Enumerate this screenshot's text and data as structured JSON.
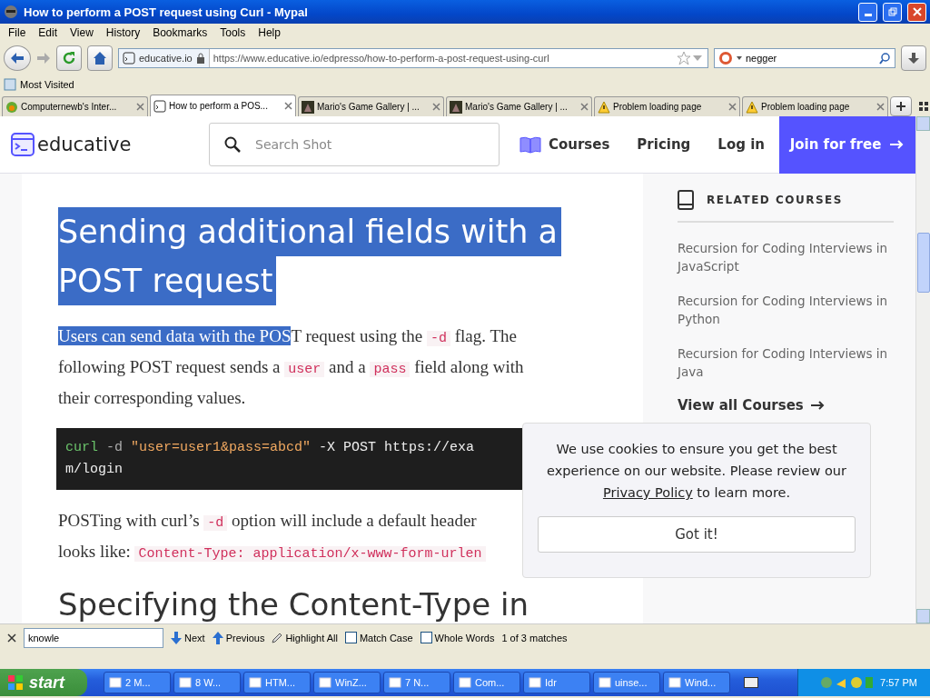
{
  "window": {
    "title": "How to perform a POST request using Curl - Mypal"
  },
  "menu": [
    "File",
    "Edit",
    "View",
    "History",
    "Bookmarks",
    "Tools",
    "Help"
  ],
  "address": {
    "site": "educative.io",
    "url": "https://www.educative.io/edpresso/how-to-perform-a-post-request-using-curl"
  },
  "search": {
    "value": "negger"
  },
  "bookmarks": [
    "Most Visited"
  ],
  "tabs": [
    {
      "label": "Computernewb's Inter...",
      "selected": false,
      "kind": "app"
    },
    {
      "label": "How to perform a POS...",
      "selected": true,
      "kind": "terminal"
    },
    {
      "label": "Mario's Game Gallery | ...",
      "selected": false,
      "kind": "dark"
    },
    {
      "label": "Mario's Game Gallery | ...",
      "selected": false,
      "kind": "dark"
    },
    {
      "label": "Problem loading page",
      "selected": false,
      "kind": "warning"
    },
    {
      "label": "Problem loading page",
      "selected": false,
      "kind": "warning"
    }
  ],
  "site": {
    "logo": "educative",
    "search_placeholder": "Search Shot",
    "nav": [
      "Courses",
      "Pricing",
      "Log in"
    ],
    "cta": "Join for free"
  },
  "article": {
    "heading_lines": [
      "Sending additional fields with a",
      "POST request"
    ],
    "paragraph_1": [
      [
        {
          "kind": "selected",
          "text": "Users can send data with the POS"
        },
        {
          "kind": "text",
          "text": "T request using the "
        },
        {
          "kind": "code",
          "text": "-d"
        },
        {
          "kind": "text",
          "text": " flag. The"
        }
      ],
      [
        {
          "kind": "text",
          "text": "following POST request sends a "
        },
        {
          "kind": "code",
          "text": "user"
        },
        {
          "kind": "text",
          "text": " and a "
        },
        {
          "kind": "code",
          "text": "pass"
        },
        {
          "kind": "text",
          "text": " field along with"
        }
      ],
      [
        {
          "kind": "text",
          "text": "their corresponding values."
        }
      ]
    ],
    "code_lines": [
      [
        {
          "kind": "command",
          "text": "curl"
        },
        {
          "kind": "flag",
          "text": " -d "
        },
        {
          "kind": "string",
          "text": "\"user=user1&pass=abcd\""
        },
        {
          "kind": "plain",
          "text": " -X POST https://exa"
        }
      ],
      [
        {
          "kind": "plain",
          "text": "m/login"
        }
      ]
    ],
    "paragraph_2": [
      [
        {
          "kind": "text",
          "text": "POSTing with curl’s "
        },
        {
          "kind": "code",
          "text": "-d"
        },
        {
          "kind": "text",
          "text": " option will include a default header"
        }
      ],
      [
        {
          "kind": "text",
          "text": "looks like: "
        },
        {
          "kind": "code",
          "text": "Content-Type: application/x-www-form-urlen"
        }
      ]
    ],
    "heading_2": "Specifying the Content-Type in"
  },
  "related": {
    "title": "RELATED COURSES",
    "courses": [
      "Recursion for Coding Interviews in JavaScript",
      "Recursion for Coding Interviews in Python",
      "Recursion for Coding Interviews in Java"
    ],
    "view_all": "View all Courses"
  },
  "cookie": {
    "text_before": "We use cookies to ensure you get the best experience on our website. Please review our ",
    "link": "Privacy Policy",
    "text_after": " to learn more.",
    "button": "Got it!"
  },
  "find_bar": {
    "value": "knowle",
    "next": "Next",
    "previous": "Previous",
    "highlight_all": "Highlight All",
    "match_case": {
      "label": "Match Case",
      "checked": false
    },
    "whole_words": {
      "label": "Whole Words",
      "checked": false
    },
    "status": "1 of 3 matches"
  },
  "taskbar": {
    "start": "start",
    "items": [
      "2 M...",
      "8 W...",
      "HTM...",
      "WinZ...",
      "7 N...",
      "Com...",
      "Idr",
      "uinse...",
      "Wind..."
    ],
    "clock": "7:57 PM"
  }
}
